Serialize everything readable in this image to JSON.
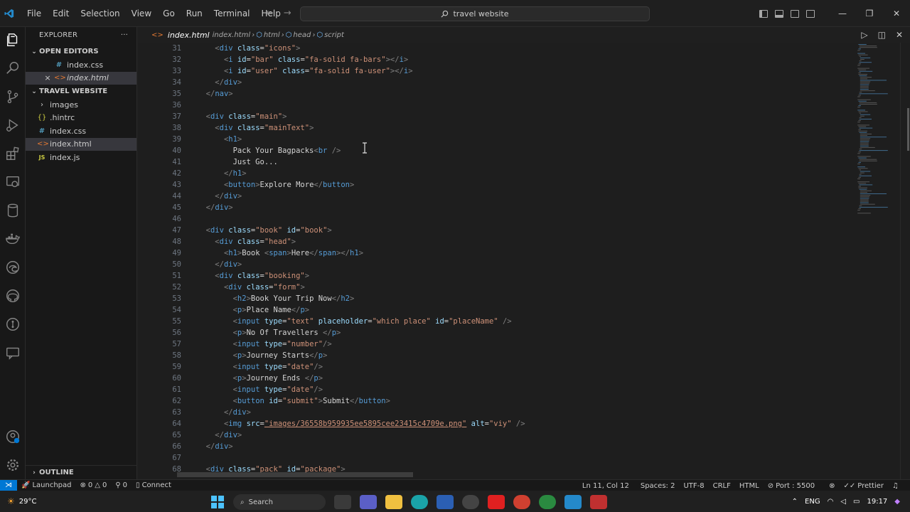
{
  "menu": [
    "File",
    "Edit",
    "Selection",
    "View",
    "Go",
    "Run",
    "Terminal",
    "Help"
  ],
  "command_center": {
    "text": "travel website"
  },
  "sidebar": {
    "title": "EXPLORER",
    "more": "···",
    "open_editors": {
      "label": "OPEN EDITORS",
      "items": [
        {
          "name": "index.css",
          "icon": "#"
        },
        {
          "name": "index.html",
          "icon": "<>",
          "close": "×"
        }
      ]
    },
    "folder": {
      "label": "TRAVEL WEBSITE",
      "items": [
        {
          "name": "images",
          "icon": "›"
        },
        {
          "name": ".hintrc",
          "icon": "{}"
        },
        {
          "name": "index.css",
          "icon": "#"
        },
        {
          "name": "index.html",
          "icon": "<>"
        },
        {
          "name": "index.js",
          "icon": "JS"
        }
      ]
    },
    "outline": "OUTLINE"
  },
  "tab": {
    "name": "index.html",
    "breadcrumb": [
      "index.html",
      "html",
      "head",
      "script"
    ],
    "icon": "<>"
  },
  "editor": {
    "line_numbers": [
      "31",
      "32",
      "33",
      "34",
      "35",
      "36",
      "37",
      "38",
      "39",
      "40",
      "41",
      "42",
      "43",
      "44",
      "45",
      "46",
      "47",
      "48",
      "49",
      "50",
      "51",
      "52",
      "53",
      "54",
      "55",
      "56",
      "57",
      "58",
      "59",
      "60",
      "61",
      "62",
      "63",
      "64",
      "65",
      "66",
      "67",
      "68"
    ],
    "lines": [
      "    <div class=\"icons\">",
      "      <i id=\"bar\" class=\"fa-solid fa-bars\"></i>",
      "      <i id=\"user\" class=\"fa-solid fa-user\"></i>",
      "    </div>",
      "  </nav>",
      "",
      "  <div class=\"main\">",
      "    <div class=\"mainText\">",
      "      <h1>",
      "        Pack Your Bagpacks<br />",
      "        Just Go...",
      "      </h1>",
      "      <button>Explore More</button>",
      "    </div>",
      "  </div>",
      "",
      "  <div class=\"book\" id=\"book\">",
      "    <div class=\"head\">",
      "      <h1>Book <span>Here</span></h1>",
      "    </div>",
      "    <div class=\"booking\">",
      "      <div class=\"form\">",
      "        <h2>Book Your Trip Now</h2>",
      "        <p>Place Name</p>",
      "        <input type=\"text\" placeholder=\"which place\" id=\"placeName\" />",
      "        <p>No Of Travellers </p>",
      "        <input type=\"number\"/>",
      "        <p>Journey Starts</p>",
      "        <input type=\"date\"/>",
      "        <p>Journey Ends </p>",
      "        <input type=\"date\"/>",
      "        <button id=\"submit\">Submit</button>",
      "      </div>",
      "      <img src=\"images/36558b959935ee5895cee23415c4709e.png\" alt=\"viy\" />",
      "    </div>",
      "  </div>",
      "",
      "  <div class=\"pack\" id=\"package\">"
    ]
  },
  "statusbar": {
    "launchpad": "Launchpad",
    "errors": "0",
    "warnings": "0",
    "ports": "0",
    "connect": "Connect",
    "position": "Ln 11, Col 12",
    "spaces": "Spaces: 2",
    "encoding": "UTF-8",
    "eol": "CRLF",
    "language": "HTML",
    "port": "Port : 5500",
    "prettier": "Prettier"
  },
  "taskbar": {
    "temperature": "29°C",
    "search": "Search",
    "lang": "ENG",
    "time": "19:17"
  },
  "colors": {
    "accent": "#0078d4",
    "tag": "#569cd6",
    "attr": "#9cdcfe",
    "string": "#ce9178",
    "bracket": "#808080"
  }
}
